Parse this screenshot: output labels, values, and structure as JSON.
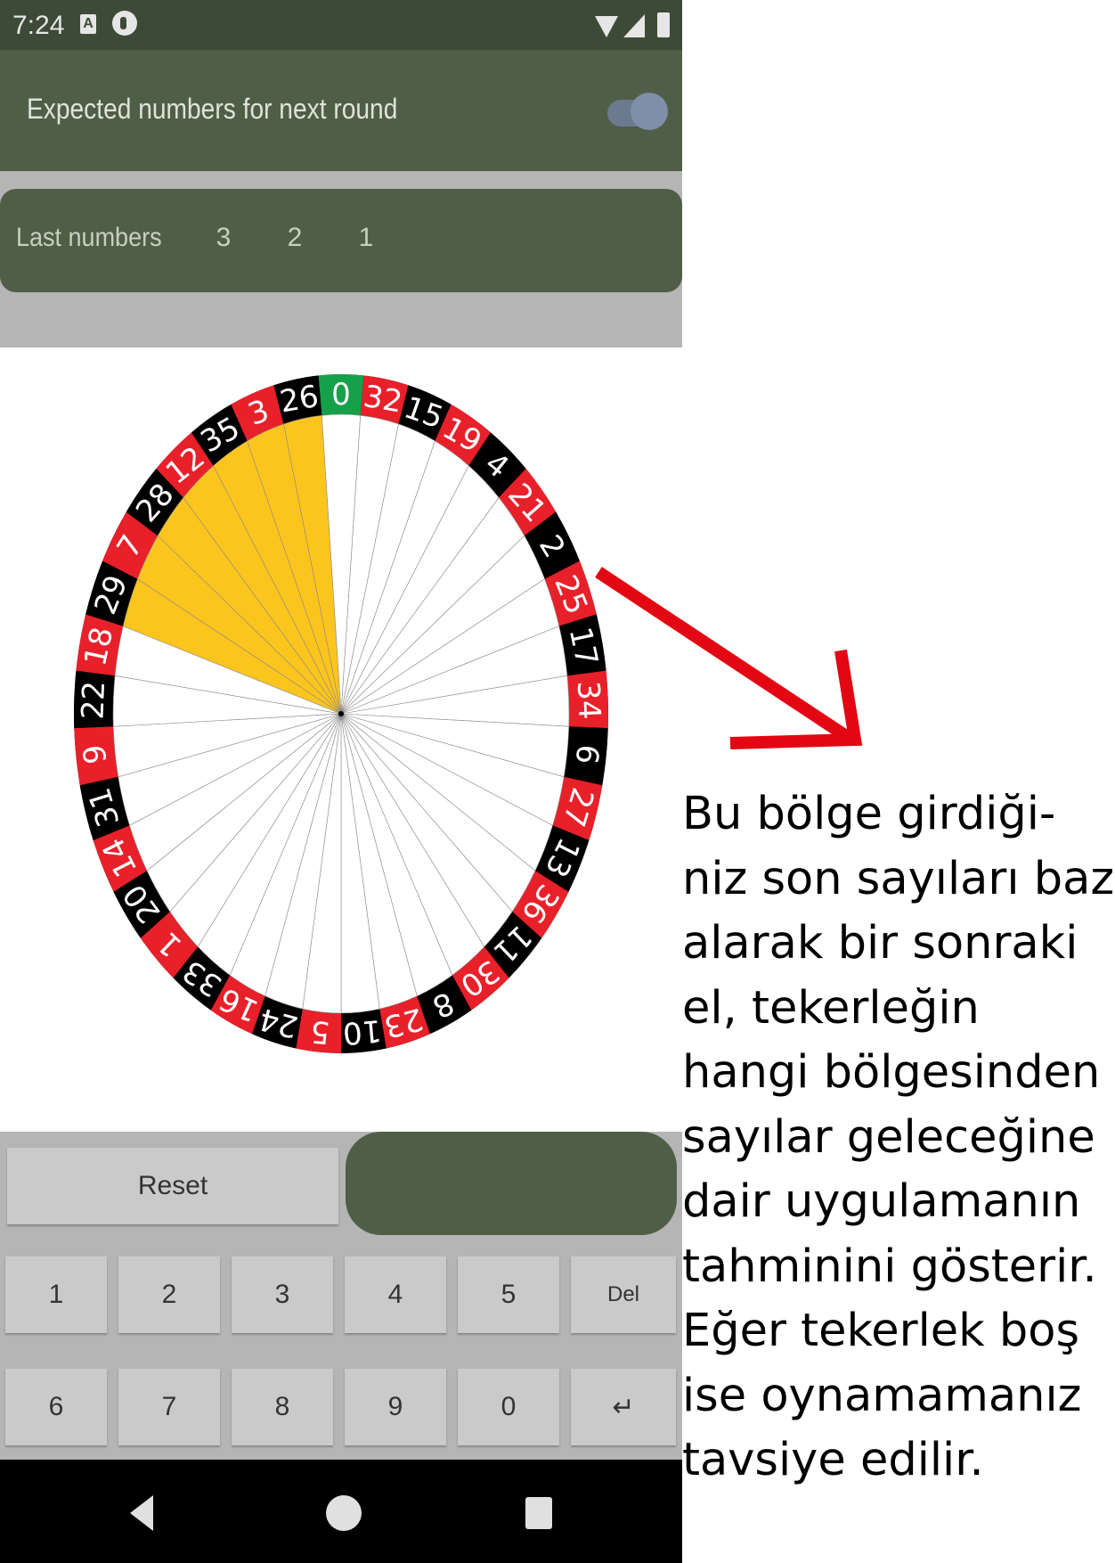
{
  "status_bar": {
    "time": "7:24",
    "icons": [
      "notification-a-icon",
      "notification-b-icon",
      "wifi-icon",
      "cell-signal-icon",
      "battery-icon"
    ]
  },
  "app_bar": {
    "title": "Expected numbers for next round",
    "toggle_on": true
  },
  "last_numbers": {
    "label": "Last numbers",
    "values": [
      "3",
      "2",
      "1"
    ]
  },
  "wheel": {
    "sequence": [
      "0",
      "32",
      "15",
      "19",
      "4",
      "21",
      "2",
      "25",
      "17",
      "34",
      "6",
      "27",
      "13",
      "36",
      "11",
      "30",
      "8",
      "23",
      "10",
      "5",
      "24",
      "16",
      "33",
      "1",
      "20",
      "14",
      "31",
      "9",
      "22",
      "18",
      "29",
      "7",
      "28",
      "12",
      "35",
      "3",
      "26"
    ],
    "highlighted": [
      "29",
      "7",
      "28",
      "12",
      "35",
      "3",
      "26"
    ],
    "colors": {
      "red": "#e8202a",
      "black": "#000000",
      "green": "#16a04a",
      "highlight": "#fcc51e",
      "empty": "#ffffff"
    }
  },
  "keypad": {
    "reset": "Reset",
    "row1": [
      "1",
      "2",
      "3",
      "4",
      "5",
      "Del"
    ],
    "row2": [
      "6",
      "7",
      "8",
      "9",
      "0",
      "↵"
    ]
  },
  "nav_bar": {
    "icons": [
      "back-icon",
      "home-icon",
      "recents-icon"
    ]
  },
  "annotation": {
    "lines": [
      "Bu bölge girdiği-",
      "niz son sayıları baz",
      "alarak bir sonraki",
      "el, tekerleğin",
      "hangi bölgesinden",
      "sayılar geleceğine",
      "dair uygulamanın",
      "tahminini gösterir.",
      "Eğer tekerlek boş",
      "ise oynamamanız",
      "tavsiye edilir."
    ],
    "arrow_color": "#e30613"
  }
}
